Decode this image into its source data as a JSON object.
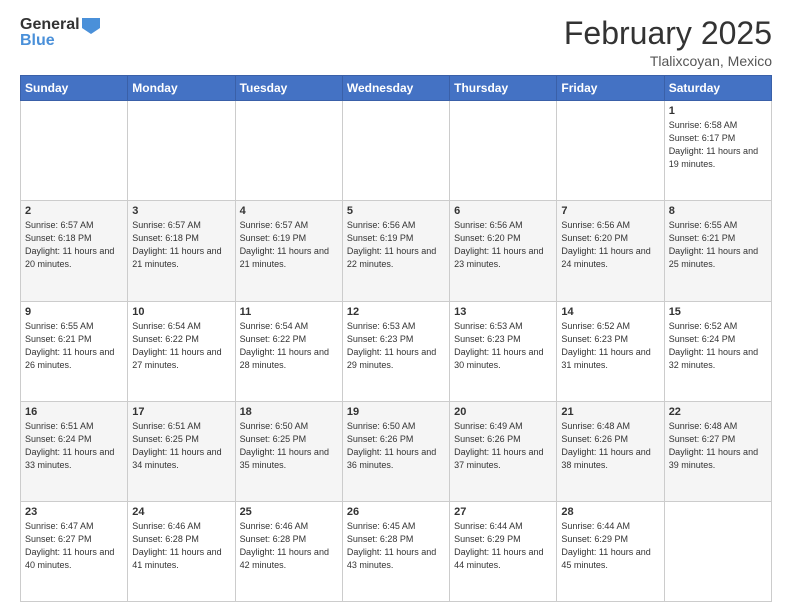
{
  "header": {
    "logo_line1": "General",
    "logo_line2": "Blue",
    "month": "February 2025",
    "location": "Tlalixcoyan, Mexico"
  },
  "weekdays": [
    "Sunday",
    "Monday",
    "Tuesday",
    "Wednesday",
    "Thursday",
    "Friday",
    "Saturday"
  ],
  "weeks": [
    [
      {
        "day": "",
        "info": ""
      },
      {
        "day": "",
        "info": ""
      },
      {
        "day": "",
        "info": ""
      },
      {
        "day": "",
        "info": ""
      },
      {
        "day": "",
        "info": ""
      },
      {
        "day": "",
        "info": ""
      },
      {
        "day": "1",
        "info": "Sunrise: 6:58 AM\nSunset: 6:17 PM\nDaylight: 11 hours and 19 minutes."
      }
    ],
    [
      {
        "day": "2",
        "info": "Sunrise: 6:57 AM\nSunset: 6:18 PM\nDaylight: 11 hours and 20 minutes."
      },
      {
        "day": "3",
        "info": "Sunrise: 6:57 AM\nSunset: 6:18 PM\nDaylight: 11 hours and 21 minutes."
      },
      {
        "day": "4",
        "info": "Sunrise: 6:57 AM\nSunset: 6:19 PM\nDaylight: 11 hours and 21 minutes."
      },
      {
        "day": "5",
        "info": "Sunrise: 6:56 AM\nSunset: 6:19 PM\nDaylight: 11 hours and 22 minutes."
      },
      {
        "day": "6",
        "info": "Sunrise: 6:56 AM\nSunset: 6:20 PM\nDaylight: 11 hours and 23 minutes."
      },
      {
        "day": "7",
        "info": "Sunrise: 6:56 AM\nSunset: 6:20 PM\nDaylight: 11 hours and 24 minutes."
      },
      {
        "day": "8",
        "info": "Sunrise: 6:55 AM\nSunset: 6:21 PM\nDaylight: 11 hours and 25 minutes."
      }
    ],
    [
      {
        "day": "9",
        "info": "Sunrise: 6:55 AM\nSunset: 6:21 PM\nDaylight: 11 hours and 26 minutes."
      },
      {
        "day": "10",
        "info": "Sunrise: 6:54 AM\nSunset: 6:22 PM\nDaylight: 11 hours and 27 minutes."
      },
      {
        "day": "11",
        "info": "Sunrise: 6:54 AM\nSunset: 6:22 PM\nDaylight: 11 hours and 28 minutes."
      },
      {
        "day": "12",
        "info": "Sunrise: 6:53 AM\nSunset: 6:23 PM\nDaylight: 11 hours and 29 minutes."
      },
      {
        "day": "13",
        "info": "Sunrise: 6:53 AM\nSunset: 6:23 PM\nDaylight: 11 hours and 30 minutes."
      },
      {
        "day": "14",
        "info": "Sunrise: 6:52 AM\nSunset: 6:23 PM\nDaylight: 11 hours and 31 minutes."
      },
      {
        "day": "15",
        "info": "Sunrise: 6:52 AM\nSunset: 6:24 PM\nDaylight: 11 hours and 32 minutes."
      }
    ],
    [
      {
        "day": "16",
        "info": "Sunrise: 6:51 AM\nSunset: 6:24 PM\nDaylight: 11 hours and 33 minutes."
      },
      {
        "day": "17",
        "info": "Sunrise: 6:51 AM\nSunset: 6:25 PM\nDaylight: 11 hours and 34 minutes."
      },
      {
        "day": "18",
        "info": "Sunrise: 6:50 AM\nSunset: 6:25 PM\nDaylight: 11 hours and 35 minutes."
      },
      {
        "day": "19",
        "info": "Sunrise: 6:50 AM\nSunset: 6:26 PM\nDaylight: 11 hours and 36 minutes."
      },
      {
        "day": "20",
        "info": "Sunrise: 6:49 AM\nSunset: 6:26 PM\nDaylight: 11 hours and 37 minutes."
      },
      {
        "day": "21",
        "info": "Sunrise: 6:48 AM\nSunset: 6:26 PM\nDaylight: 11 hours and 38 minutes."
      },
      {
        "day": "22",
        "info": "Sunrise: 6:48 AM\nSunset: 6:27 PM\nDaylight: 11 hours and 39 minutes."
      }
    ],
    [
      {
        "day": "23",
        "info": "Sunrise: 6:47 AM\nSunset: 6:27 PM\nDaylight: 11 hours and 40 minutes."
      },
      {
        "day": "24",
        "info": "Sunrise: 6:46 AM\nSunset: 6:28 PM\nDaylight: 11 hours and 41 minutes."
      },
      {
        "day": "25",
        "info": "Sunrise: 6:46 AM\nSunset: 6:28 PM\nDaylight: 11 hours and 42 minutes."
      },
      {
        "day": "26",
        "info": "Sunrise: 6:45 AM\nSunset: 6:28 PM\nDaylight: 11 hours and 43 minutes."
      },
      {
        "day": "27",
        "info": "Sunrise: 6:44 AM\nSunset: 6:29 PM\nDaylight: 11 hours and 44 minutes."
      },
      {
        "day": "28",
        "info": "Sunrise: 6:44 AM\nSunset: 6:29 PM\nDaylight: 11 hours and 45 minutes."
      },
      {
        "day": "",
        "info": ""
      }
    ]
  ]
}
